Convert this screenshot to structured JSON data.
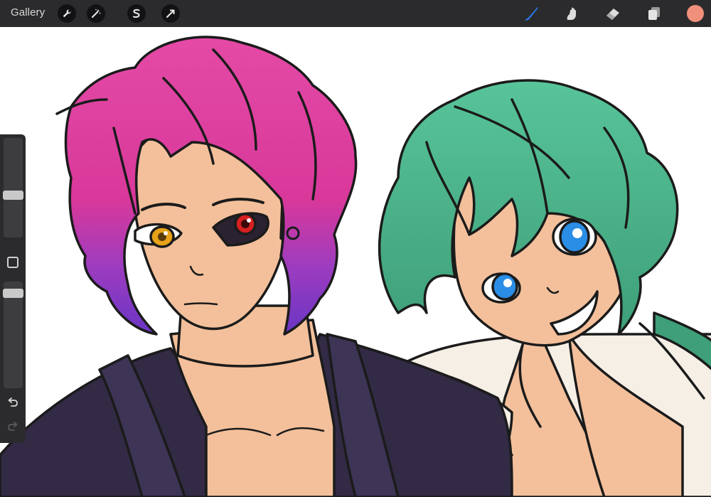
{
  "toolbar": {
    "gallery_label": "Gallery",
    "left_tools": [
      {
        "icon": "wrench-icon",
        "name": "actions"
      },
      {
        "icon": "magic-wand-icon",
        "name": "adjustments"
      },
      {
        "icon": "selection-icon",
        "name": "selection"
      },
      {
        "icon": "arrow-cursor-icon",
        "name": "transform"
      }
    ],
    "right_tools": [
      {
        "icon": "brush-icon",
        "name": "paint",
        "active": true
      },
      {
        "icon": "smudge-icon",
        "name": "smudge"
      },
      {
        "icon": "eraser-icon",
        "name": "erase"
      },
      {
        "icon": "layers-icon",
        "name": "layers"
      }
    ],
    "current_color": "#f0907a",
    "active_tool_color": "#2a7cf0"
  },
  "sidebar": {
    "brush_size_level": 0.42,
    "opacity_level": 0.93,
    "modify_icon": "square-icon",
    "undo_icon": "undo-icon",
    "redo_icon": "redo-icon"
  },
  "canvas": {
    "subject": "illustration",
    "palette": {
      "pink_hair": "#e0399b",
      "purple_hair": "#7a3cc4",
      "green_hair": "#4fb58a",
      "skin": "#f3c09b",
      "robe": "#332a45",
      "shirt": "#f6efe6",
      "eye_gold": "#e8a21a",
      "eye_red": "#d62020",
      "eye_blue": "#2a8de6"
    }
  }
}
